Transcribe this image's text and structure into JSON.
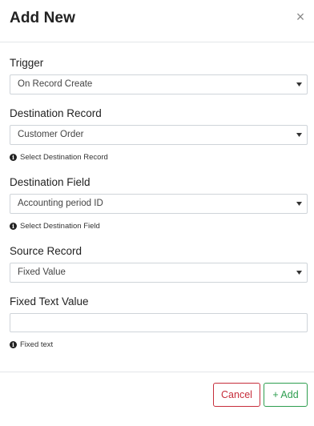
{
  "dialog": {
    "title": "Add New",
    "close_symbol": "×"
  },
  "fields": {
    "trigger": {
      "label": "Trigger",
      "value": "On Record Create"
    },
    "destination_record": {
      "label": "Destination Record",
      "value": "Customer Order",
      "hint": "Select Destination Record"
    },
    "destination_field": {
      "label": "Destination Field",
      "value": "Accounting period ID",
      "hint": "Select Destination Field"
    },
    "source_record": {
      "label": "Source Record",
      "value": "Fixed Value"
    },
    "fixed_text_value": {
      "label": "Fixed Text Value",
      "value": "",
      "hint": "Fixed text"
    }
  },
  "icons": {
    "hint_icon": "info-circle-icon",
    "caret_icon": "caret-down-icon",
    "close_icon": "close-icon"
  },
  "buttons": {
    "cancel_label": "Cancel",
    "add_label": "+ Add"
  },
  "colors": {
    "cancel": "#c62d3b",
    "add": "#2e9e4f"
  }
}
